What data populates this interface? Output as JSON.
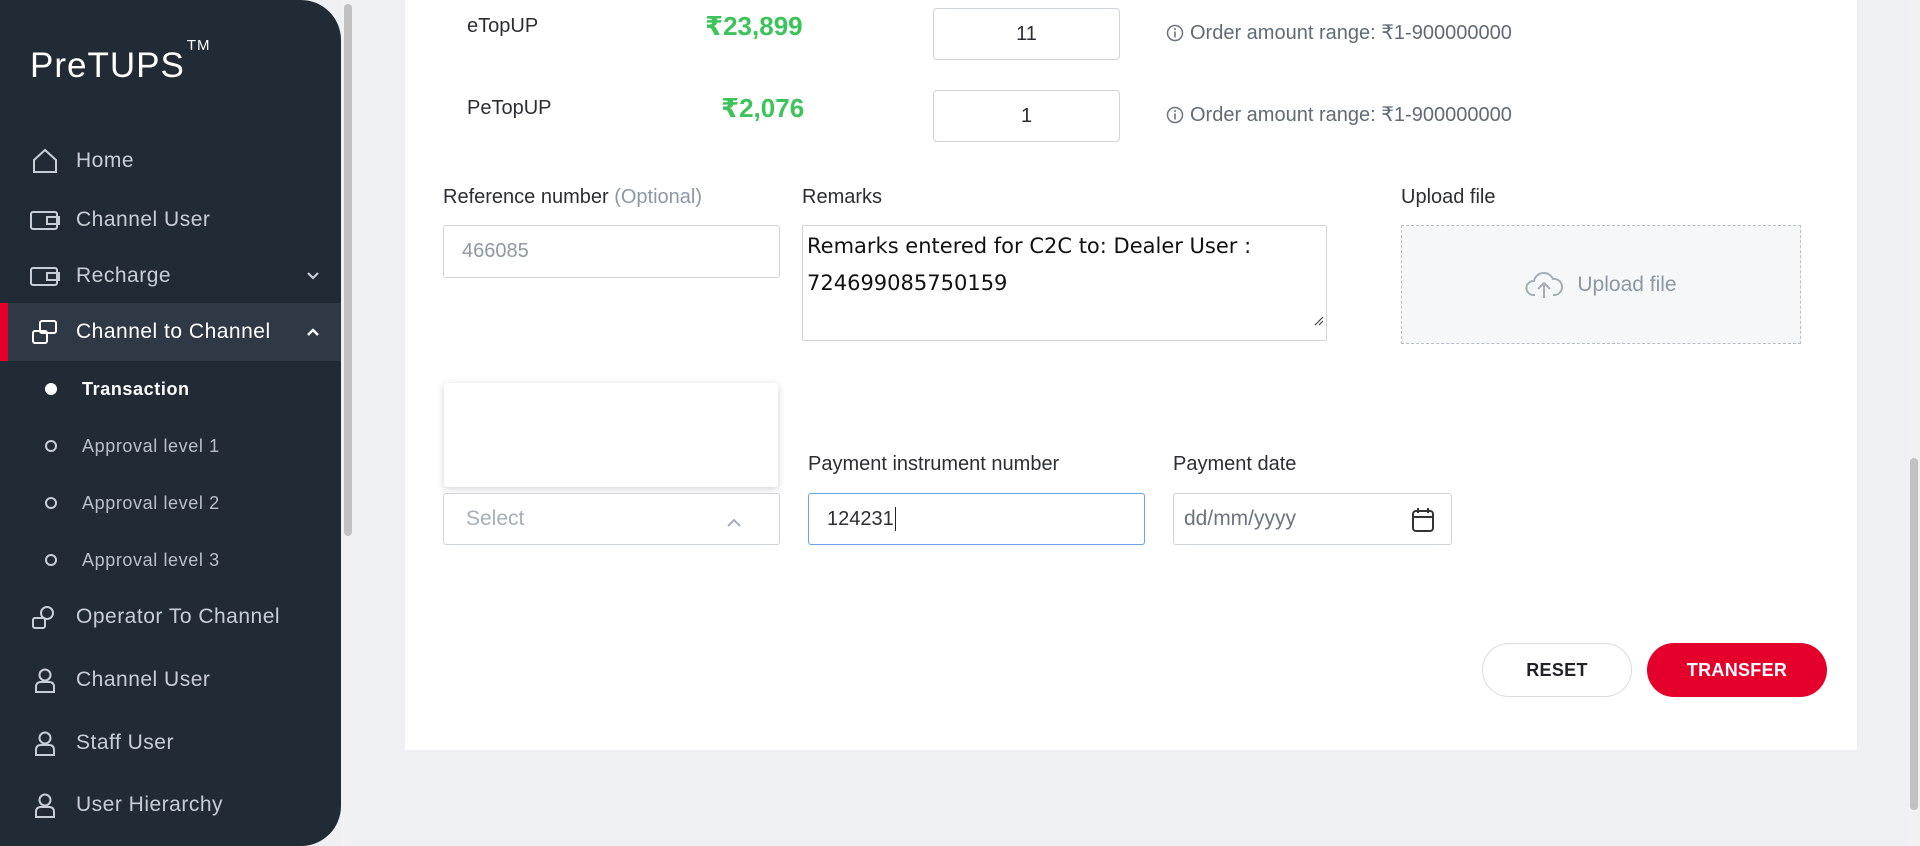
{
  "app": {
    "logo": "PreTUPS",
    "logo_tm": "TM"
  },
  "sidebar": {
    "items": [
      {
        "label": "Home"
      },
      {
        "label": "Channel User"
      },
      {
        "label": "Recharge"
      },
      {
        "label": "Channel to Channel"
      },
      {
        "label": "Operator To Channel"
      },
      {
        "label": "Channel User"
      },
      {
        "label": "Staff User"
      },
      {
        "label": "User Hierarchy"
      }
    ],
    "subitems": [
      {
        "label": "Transaction"
      },
      {
        "label": "Approval level 1"
      },
      {
        "label": "Approval level 2"
      },
      {
        "label": "Approval level 3"
      }
    ]
  },
  "wallets": [
    {
      "name": "eTopUP",
      "balance": "₹23,899",
      "quantity": "11",
      "range": "Order amount range: ₹1-900000000"
    },
    {
      "name": "PeTopUP",
      "balance": "₹2,076",
      "quantity": "1",
      "range": "Order amount range: ₹1-900000000"
    }
  ],
  "form": {
    "reference_label": "Reference number",
    "reference_optional": "(Optional)",
    "reference_value": "466085",
    "remarks_label": "Remarks",
    "remarks_value": "Remarks entered for C2C to: Dealer User : 724699085750159",
    "upload_label": "Upload file",
    "upload_button": "Upload file",
    "payment_type_placeholder": "Select",
    "payment_instrument_label": "Payment instrument number",
    "payment_instrument_value": "124231",
    "payment_date_label": "Payment date",
    "payment_date_placeholder": "dd/mm/yyyy"
  },
  "actions": {
    "reset": "RESET",
    "transfer": "TRANSFER"
  },
  "colors": {
    "sidebar": "#212b36",
    "accent": "#e4002b",
    "balance": "#3cc35a"
  }
}
